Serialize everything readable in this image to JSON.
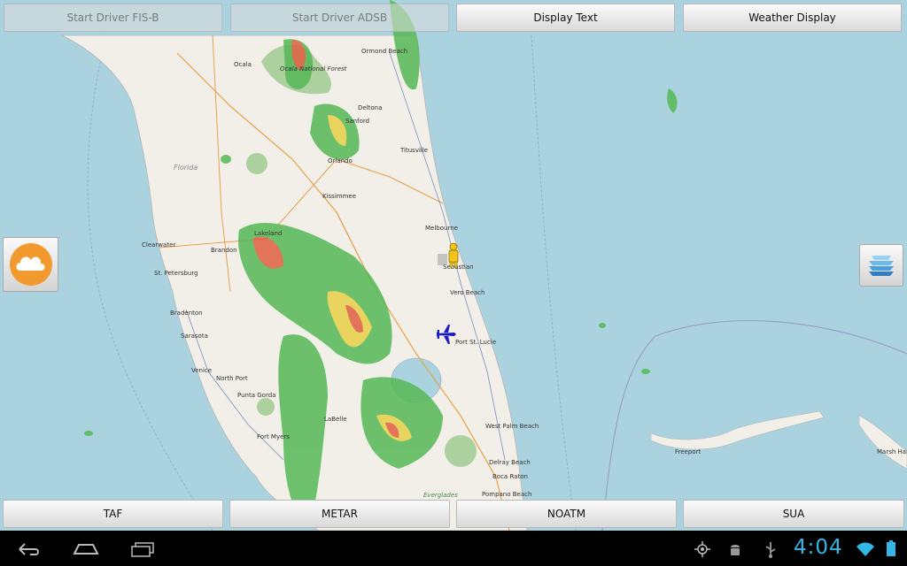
{
  "top_buttons": {
    "fisb": "Start Driver FIS-B",
    "adsb": "Start Driver ADSB",
    "display_text": "Display Text",
    "weather_display": "Weather Display"
  },
  "bottom_buttons": {
    "taf": "TAF",
    "metar": "METAR",
    "notam": "NOATM",
    "sua": "SUA"
  },
  "map_labels": {
    "ocala": "Ocala",
    "ocala_forest": "Ocala National Forest",
    "ormond": "Ormond Beach",
    "deltona": "Deltona",
    "sanford": "Sanford",
    "titusville": "Titusville",
    "orlando": "Orlando",
    "florida": "Florida",
    "kissimmee": "Kissimmee",
    "lakeland": "Lakeland",
    "melbourne": "Melbourne",
    "clearwater": "Clearwater",
    "brandon": "Brandon",
    "sebastian": "Sebastian",
    "st_petersburg": "St. Petersburg",
    "vero_beach": "Vero Beach",
    "bradenton": "Bradenton",
    "sarasota": "Sarasota",
    "port_st_lucie": "Port St. Lucie",
    "venice": "Venice",
    "north_port": "North Port",
    "punta_gorda": "Punta Gorda",
    "labelle": "LaBelle",
    "fort_myers": "Fort Myers",
    "west_palm": "West Palm Beach",
    "delray": "Delray Beach",
    "boca": "Boca Raton",
    "pompano": "Pompano Beach",
    "everglades": "Everglades",
    "freeport": "Freeport",
    "marsh_harbour": "Marsh Harb"
  },
  "status_bar": {
    "time": "4:04"
  },
  "colors": {
    "sea": "#aad3df",
    "land": "#f2efe9",
    "forest": "#add19e",
    "radar_green": "#56b856",
    "radar_yellow": "#e8d048",
    "radar_red": "#e06040",
    "accent": "#33b5e5",
    "weather_orange": "#f29a2e"
  },
  "icons": {
    "weather": "cloud-icon",
    "layers": "layers-icon",
    "aircraft": "airplane-icon",
    "pegman": "person-icon"
  }
}
